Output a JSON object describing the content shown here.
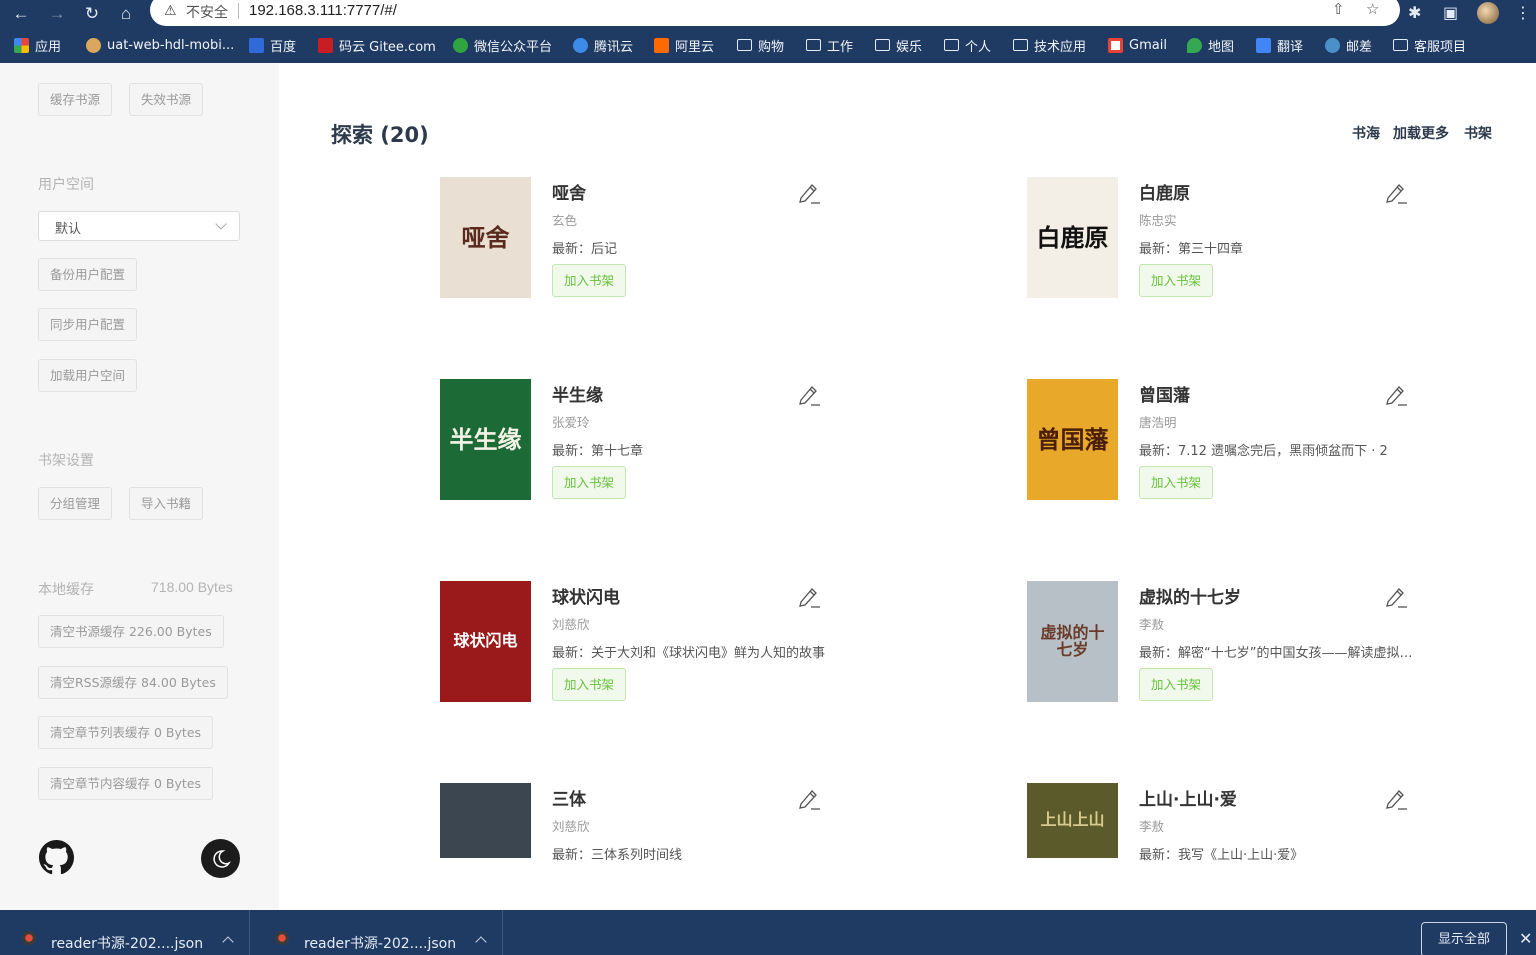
{
  "browser": {
    "insecure_label": "不安全",
    "url": "192.168.3.111:7777/#/"
  },
  "bookmarks": [
    {
      "label": "应用",
      "icon": "apps-grid-icon",
      "color": "#e8453c"
    },
    {
      "label": "uat-web-hdl-mobi...",
      "icon": "avatar-favicon-icon",
      "color": "#d9a85c"
    },
    {
      "label": "百度",
      "icon": "baidu-icon",
      "color": "#2f6ad8"
    },
    {
      "label": "码云 Gitee.com",
      "icon": "gitee-icon",
      "color": "#c71d23"
    },
    {
      "label": "微信公众平台",
      "icon": "wechat-icon",
      "color": "#2ea541"
    },
    {
      "label": "腾讯云",
      "icon": "tencent-cloud-icon",
      "color": "#3b8be8"
    },
    {
      "label": "阿里云",
      "icon": "aliyun-icon",
      "color": "#ff6a00"
    },
    {
      "label": "购物",
      "icon": "folder-icon"
    },
    {
      "label": "工作",
      "icon": "folder-icon"
    },
    {
      "label": "娱乐",
      "icon": "folder-icon"
    },
    {
      "label": "个人",
      "icon": "folder-icon"
    },
    {
      "label": "技术应用",
      "icon": "folder-icon"
    },
    {
      "label": "Gmail",
      "icon": "gmail-icon",
      "color": "#ea4335"
    },
    {
      "label": "地图",
      "icon": "maps-icon",
      "color": "#34a853"
    },
    {
      "label": "翻译",
      "icon": "translate-icon",
      "color": "#4285f4"
    },
    {
      "label": "邮差",
      "icon": "postman-icon",
      "color": "#4a90c9"
    },
    {
      "label": "客服项目",
      "icon": "folder-icon"
    }
  ],
  "sidebar": {
    "source_buttons": [
      "缓存书源",
      "失效书源"
    ],
    "user_space_title": "用户空间",
    "user_space_select": "默认",
    "user_buttons": [
      "备份用户配置",
      "同步用户配置",
      "加载用户空间"
    ],
    "shelf_settings_title": "书架设置",
    "shelf_buttons": [
      "分组管理",
      "导入书籍"
    ],
    "local_cache_title": "本地缓存",
    "local_cache_size": "718.00 Bytes",
    "cache_buttons": [
      "清空书源缓存 226.00 Bytes",
      "清空RSS源缓存 84.00 Bytes",
      "清空章节列表缓存 0 Bytes",
      "清空章节内容缓存 0 Bytes"
    ]
  },
  "main": {
    "title": "探索 (20)",
    "links": [
      "书海",
      "加载更多",
      "书架"
    ],
    "add_label": "加入书架",
    "books": [
      {
        "title": "哑舍",
        "author": "玄色",
        "latest": "最新：后记",
        "cover_text": "哑舍",
        "cover_bg": "#e9dfd3",
        "cover_fg": "#5a2a1e"
      },
      {
        "title": "白鹿原",
        "author": "陈忠实",
        "latest": "最新：第三十四章",
        "cover_text": "白鹿原",
        "cover_bg": "#f3eee6",
        "cover_fg": "#111111"
      },
      {
        "title": "半生缘",
        "author": "张爱玲",
        "latest": "最新：第十七章",
        "cover_text": "半生缘",
        "cover_bg": "#1c6a36",
        "cover_fg": "#f5f2e6"
      },
      {
        "title": "曾国藩",
        "author": "唐浩明",
        "latest": "最新：7.12 遗嘱念完后，黑雨倾盆而下 · 2",
        "cover_text": "曾国藩",
        "cover_bg": "#e8a82a",
        "cover_fg": "#4a1e08"
      },
      {
        "title": "球状闪电",
        "author": "刘慈欣",
        "latest": "最新：关于大刘和《球状闪电》鲜为人知的故事",
        "cover_text": "球状闪电",
        "cover_bg": "#9a1a1c",
        "cover_fg": "#ffffff"
      },
      {
        "title": "虚拟的十七岁",
        "author": "李敖",
        "latest": "最新：解密“十七岁”的中国女孩——解读虚拟的十七岁",
        "cover_text": "虚拟的十七岁",
        "cover_bg": "#b6c0c6",
        "cover_fg": "#6b3b2a"
      },
      {
        "title": "三体",
        "author": "刘慈欣",
        "latest": "最新：三体系列时间线",
        "cover_text": "",
        "cover_bg": "#3c4650",
        "cover_fg": "#cccccc"
      },
      {
        "title": "上山·上山·爱",
        "author": "李敖",
        "latest": "最新：我写《上山·上山·爱》",
        "cover_text": "上山上山",
        "cover_bg": "#5a5a2a",
        "cover_fg": "#d8c98c"
      }
    ]
  },
  "downloads": {
    "items": [
      "reader书源-202....json",
      "reader书源-202....json"
    ],
    "show_all": "显示全部"
  }
}
